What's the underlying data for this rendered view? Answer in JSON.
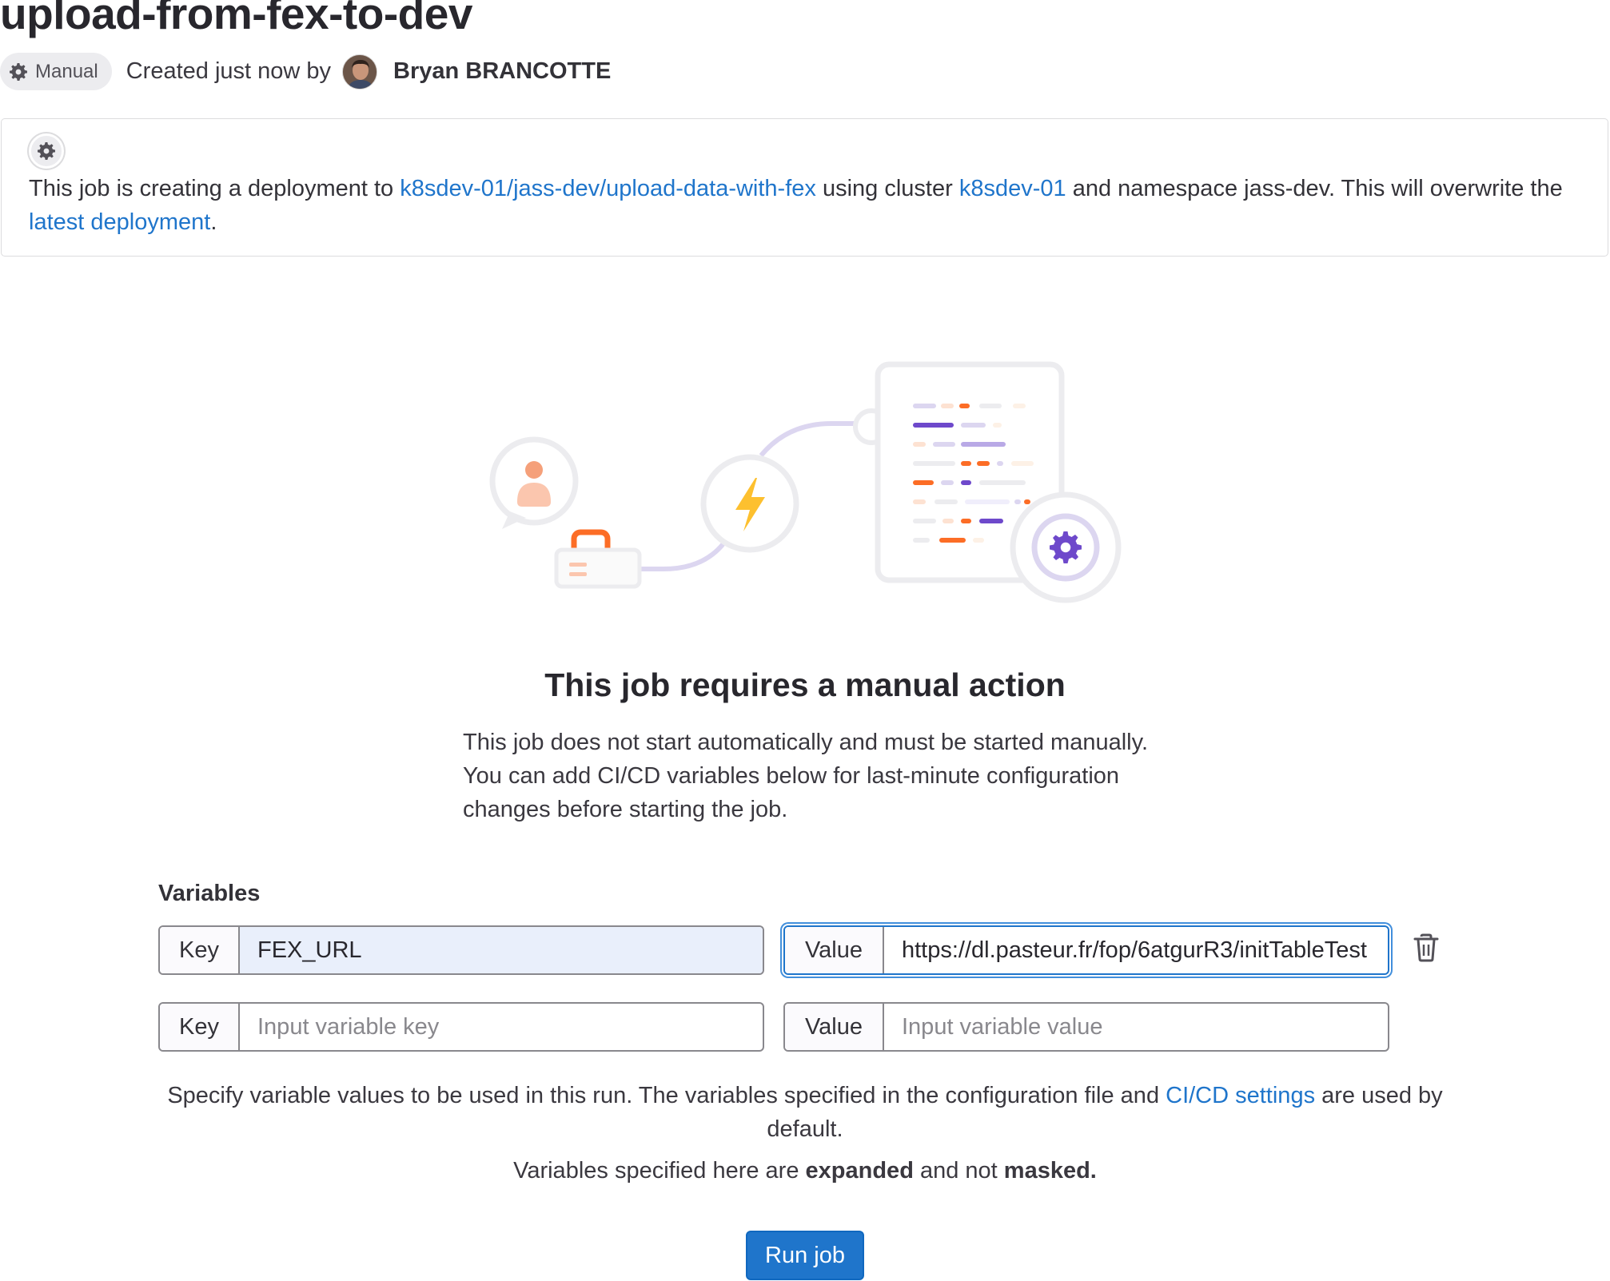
{
  "job": {
    "title": "upload-from-fex-to-dev",
    "status_badge": "Manual",
    "created_text": "Created just now by",
    "author": "Bryan BRANCOTTE"
  },
  "deployment_notice": {
    "text_1": "This job is creating a deployment to ",
    "environment_link": "k8sdev-01/jass-dev/upload-data-with-fex",
    "text_2": " using cluster ",
    "cluster_link": "k8sdev-01",
    "text_3": " and namespace jass-dev. This will overwrite the ",
    "latest_deployment_link": "latest deployment",
    "text_4": "."
  },
  "empty_state": {
    "title": "This job requires a manual action",
    "description": "This job does not start automatically and must be started manually. You can add CI/CD variables below for last-minute configuration changes before starting the job."
  },
  "variables": {
    "label": "Variables",
    "rows": [
      {
        "key_label": "Key",
        "key_value": "FEX_URL",
        "value_label": "Value",
        "value_value": "https://dl.pasteur.fr/fop/6atgurR3/initTableTest"
      },
      {
        "key_label": "Key",
        "key_placeholder": "Input variable key",
        "value_label": "Value",
        "value_placeholder": "Input variable value"
      }
    ],
    "help_text_1": "Specify variable values to be used in this run. The variables specified in the configuration file and ",
    "help_link": "CI/CD settings",
    "help_text_2": " are used by default.",
    "expand_text_1": "Variables specified here are ",
    "expand_bold_1": "expanded",
    "expand_text_2": " and not ",
    "expand_bold_2": "masked."
  },
  "actions": {
    "run_job": "Run job"
  },
  "colors": {
    "link": "#1f75cb",
    "primary_button": "#1f75cb",
    "badge_bg": "#ececef",
    "illustration_purple": "#6e49cb",
    "illustration_orange": "#fc6d26"
  },
  "icons": {
    "status": "gear-icon",
    "delete": "trash-icon"
  }
}
